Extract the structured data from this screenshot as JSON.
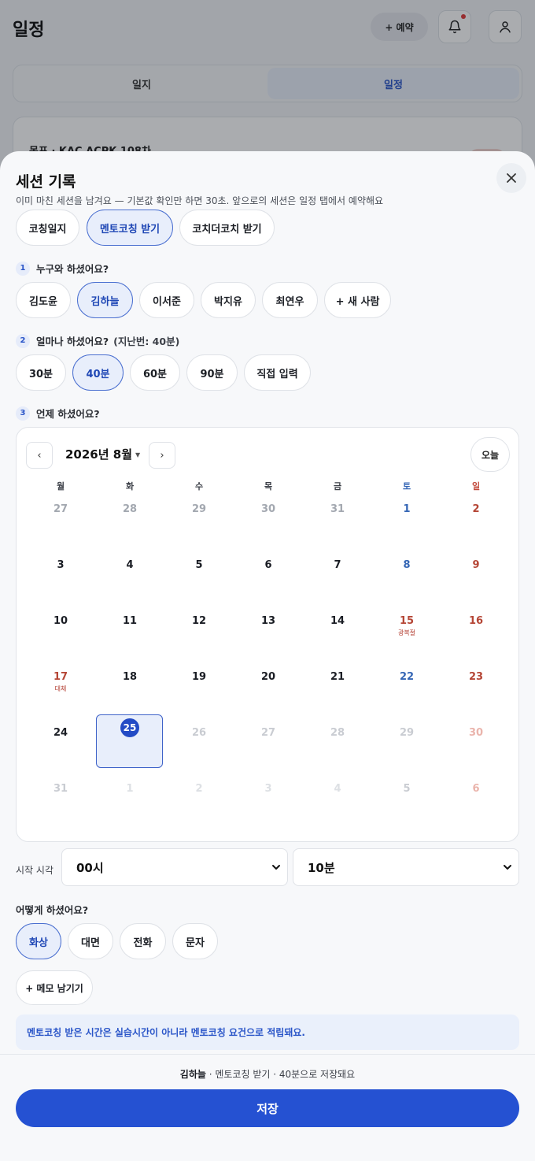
{
  "background": {
    "title": "일정",
    "reserve_label": "+ 예약",
    "tabs": [
      {
        "label": "일지",
        "active": false
      },
      {
        "label": "일정",
        "active": true
      }
    ],
    "card_title": "목표 · KAC ACPK 108차"
  },
  "sheet": {
    "title": "세션 기록",
    "subtitle": "이미 마친 세션을 남겨요 — 기본값 확인만 하면 30초. 앞으로의 세션은 일정 탭에서 예약해요",
    "types": [
      {
        "label": "코칭일지",
        "selected": false
      },
      {
        "label": "멘토코칭 받기",
        "selected": true
      },
      {
        "label": "코치더코치 받기",
        "selected": false
      }
    ],
    "step1": {
      "num": "1",
      "label": "누구와 하셨어요?"
    },
    "people": [
      {
        "label": "김도윤",
        "selected": false
      },
      {
        "label": "김하늘",
        "selected": true
      },
      {
        "label": "이서준",
        "selected": false
      },
      {
        "label": "박지유",
        "selected": false
      },
      {
        "label": "최연우",
        "selected": false
      },
      {
        "label": "+ 새 사람",
        "selected": false
      }
    ],
    "step2": {
      "num": "2",
      "label": "얼마나 하셨어요?",
      "hint": "(지난번: 40분)"
    },
    "durations": [
      {
        "label": "30분",
        "selected": false
      },
      {
        "label": "40분",
        "selected": true
      },
      {
        "label": "60분",
        "selected": false
      },
      {
        "label": "90분",
        "selected": false
      },
      {
        "label": "직접 입력",
        "selected": false
      }
    ],
    "step3": {
      "num": "3",
      "label": "언제 하셨어요?"
    },
    "calendar": {
      "prev": "‹",
      "next": "›",
      "month_label": "2026년 8월",
      "today_label": "오늘",
      "weekdays": [
        "월",
        "화",
        "수",
        "목",
        "금",
        "토",
        "일"
      ],
      "weeks": [
        [
          "27",
          "28",
          "29",
          "30",
          "31",
          "1",
          "2"
        ],
        [
          "3",
          "4",
          "5",
          "6",
          "7",
          "8",
          "9"
        ],
        [
          "10",
          "11",
          "12",
          "13",
          "14",
          "15",
          "16"
        ],
        [
          "17",
          "18",
          "19",
          "20",
          "21",
          "22",
          "23"
        ],
        [
          "24",
          "25",
          "26",
          "27",
          "28",
          "29",
          "30"
        ],
        [
          "31",
          "1",
          "2",
          "3",
          "4",
          "5",
          "6"
        ]
      ],
      "holidays": {
        "15": "광복절",
        "17": "대체"
      },
      "selected": "25"
    },
    "time": {
      "label": "시작 시각",
      "hour": "00시",
      "minute": "10분"
    },
    "how": {
      "label": "어떻게 하셨어요?",
      "modes": [
        {
          "label": "화상",
          "selected": true
        },
        {
          "label": "대면",
          "selected": false
        },
        {
          "label": "전화",
          "selected": false
        },
        {
          "label": "문자",
          "selected": false
        }
      ]
    },
    "memo_label": "+ 메모 남기기",
    "notice": "멘토코칭 받은 시간은 실습시간이 아니라 멘토코칭 요건으로 적립돼요.",
    "footer": {
      "summary_name": "김하늘",
      "summary_rest": " · 멘토코칭 받기 · 40분으로 저장돼요",
      "save_label": "저장"
    }
  },
  "colors": {
    "accent": "#2551d2",
    "selected_bg": "#e8eefb",
    "saturday": "#3566b5",
    "sunday": "#b54636"
  }
}
